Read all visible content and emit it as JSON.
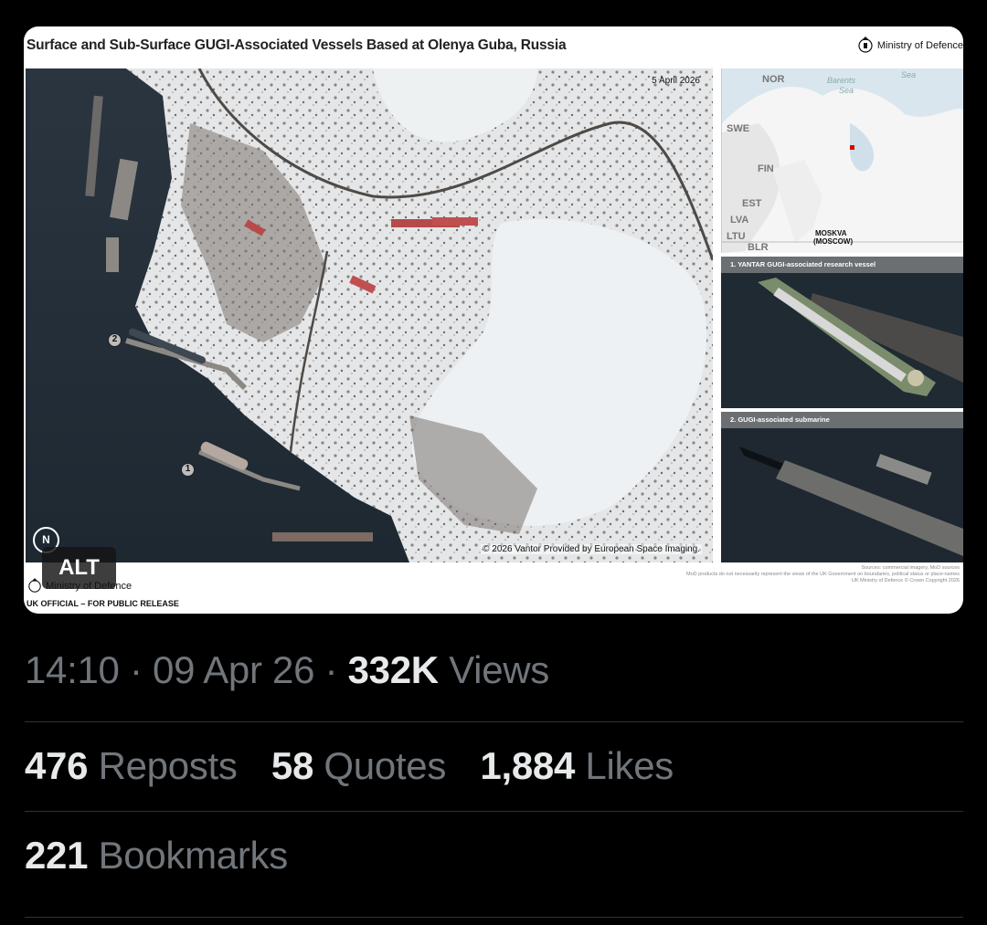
{
  "image": {
    "title": "Surface and Sub-Surface GUGI-Associated Vessels Based at Olenya Guba, Russia",
    "brand": "Ministry of Defence",
    "date_stamp": "5 April 2026",
    "credit": "© 2026 Vantor Provided by European Space Imaging.",
    "north_label": "N",
    "markers": [
      "2",
      "1"
    ],
    "inset_map": {
      "labels": [
        "NOR",
        "SWE",
        "FIN",
        "EST",
        "LVA",
        "LTU",
        "BLR"
      ],
      "sea_labels": [
        "Barents",
        "Sea",
        "Sea"
      ],
      "city": "MOSKVA",
      "city_alt": "(MOSCOW)"
    },
    "panel_1_caption": "1. YANTAR GUGI-associated research vessel",
    "panel_2_caption": "2. GUGI-associated submarine",
    "footer_brand": "Ministry of Defence",
    "classification": "UK OFFICIAL – FOR PUBLIC RELEASE",
    "disclaimer": [
      "Sources: commercial imagery, MoD sources",
      "MoD products do not necessarily represent the views of the UK Government on boundaries, political status or place-names",
      "UK Ministry of Defence © Crown Copyright 2026"
    ]
  },
  "alt_badge": "ALT",
  "meta": {
    "time": "14:10",
    "separator": "·",
    "date": "09 Apr 26",
    "views_count": "332K",
    "views_label": "Views"
  },
  "stats": {
    "reposts_count": "476",
    "reposts_label": "Reposts",
    "quotes_count": "58",
    "quotes_label": "Quotes",
    "likes_count": "1,884",
    "likes_label": "Likes",
    "bookmarks_count": "221",
    "bookmarks_label": "Bookmarks"
  },
  "colors": {
    "background": "#000000",
    "primary_text": "#e7e9ea",
    "secondary_text": "#71767b",
    "divider": "#2f3336"
  }
}
